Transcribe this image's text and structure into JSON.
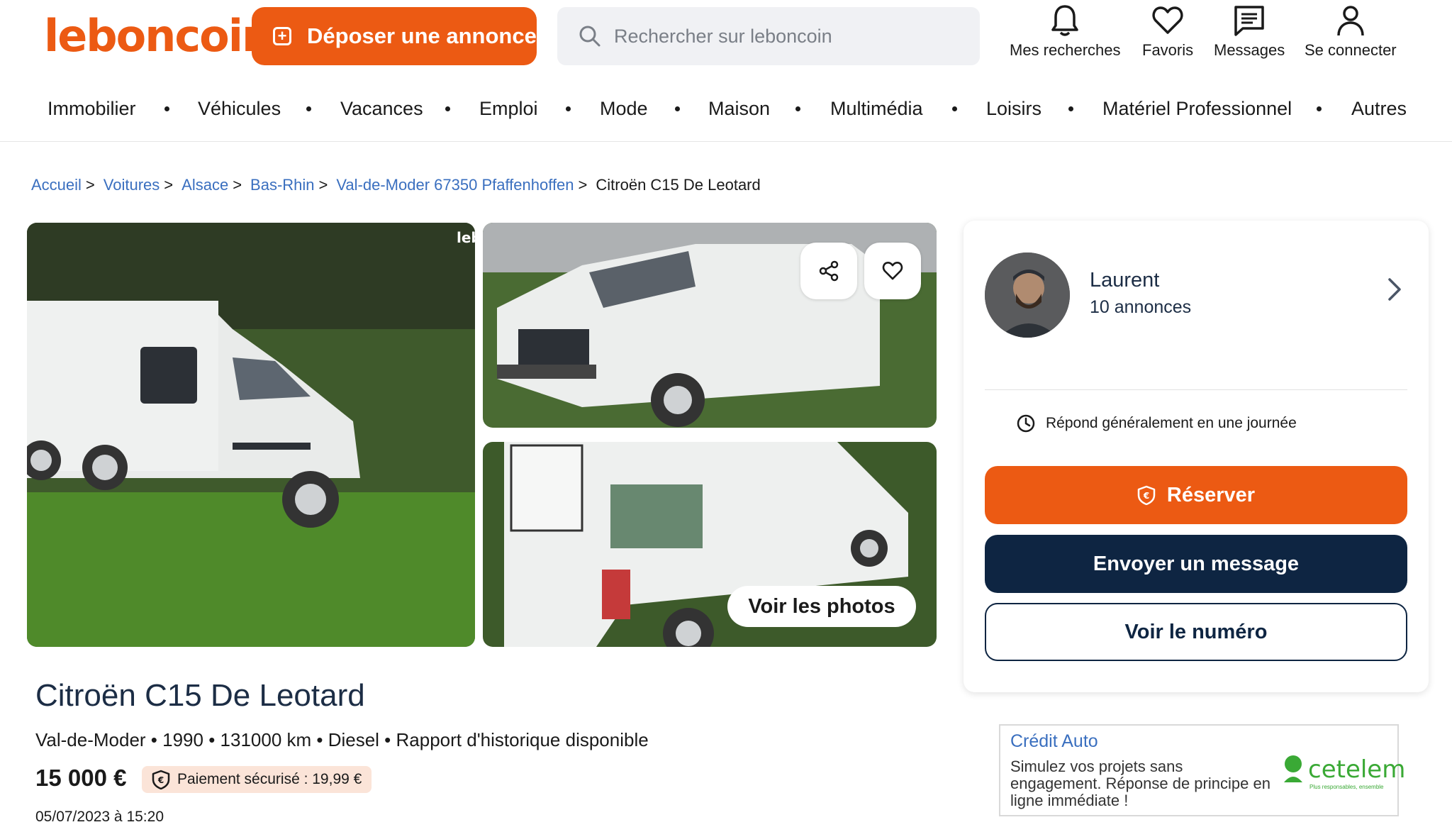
{
  "header": {
    "logo": "leboncoin",
    "deposit_label": "Déposer une annonce",
    "search_placeholder": "Rechercher sur leboncoin",
    "links": {
      "searches": "Mes recherches",
      "favorites": "Favoris",
      "messages": "Messages",
      "login": "Se connecter"
    }
  },
  "categories": [
    "Immobilier",
    "Véhicules",
    "Vacances",
    "Emploi",
    "Mode",
    "Maison",
    "Multimédia",
    "Loisirs",
    "Matériel Professionnel",
    "Autres"
  ],
  "breadcrumb": {
    "home": "Accueil",
    "cars": "Voitures",
    "region": "Alsace",
    "department": "Bas-Rhin",
    "city": "Val-de-Moder 67350 Pfaffenhoffen",
    "current": "Citroën C15 De Leotard",
    "separator": ">"
  },
  "gallery": {
    "see_photos": "Voir les photos",
    "watermark": "leb"
  },
  "listing": {
    "title": "Citroën C15 De Leotard",
    "specs": "Val-de-Moder • 1990 • 131000 km • Diesel • Rapport d'historique disponible",
    "price": "15 000 €",
    "secure_payment": "Paiement sécurisé : 19,99 €",
    "date": "05/07/2023 à 15:20"
  },
  "seller": {
    "name": "Laurent",
    "listings_count": "10 annonces",
    "response_time": "Répond généralement en une journée",
    "reserve_label": "Réserver",
    "message_label": "Envoyer un message",
    "number_label": "Voir le numéro"
  },
  "ad": {
    "title": "Crédit Auto",
    "text": "Simulez vos projets sans engagement. Réponse de principe en ligne immédiate !",
    "brand": "cetelem",
    "tagline": "Plus responsables, ensemble"
  },
  "colors": {
    "brand_orange": "#ec5a13",
    "navy": "#0e2542",
    "link_blue": "#3a6fbf"
  }
}
